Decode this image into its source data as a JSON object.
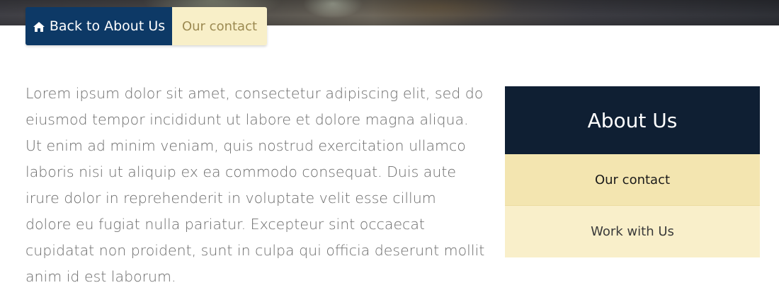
{
  "breadcrumb": {
    "back_label": "Back to About Us",
    "current_label": "Our contact",
    "back_icon": "home-icon"
  },
  "content": {
    "paragraph": "Lorem ipsum dolor sit amet, consectetur adipiscing elit, sed do eiusmod tempor incididunt ut labore et dolore magna aliqua. Ut enim ad minim veniam, quis nostrud exercitation ullamco laboris nisi ut aliquip ex ea commodo consequat. Duis aute irure dolor in reprehenderit in voluptate velit esse cillum dolore eu fugiat nulla pariatur. Excepteur sint occaecat cupidatat non proident, sunt in culpa qui officia deserunt mollit anim id est laborum."
  },
  "sidebar": {
    "title": "About Us",
    "items": [
      {
        "label": "Our contact",
        "active": true
      },
      {
        "label": "Work with Us",
        "active": false
      }
    ]
  },
  "colors": {
    "navy": "#0d3966",
    "sidebar_header": "#0f1f33",
    "active_bg": "#f3e5b0",
    "item_bg": "#f9efca"
  }
}
